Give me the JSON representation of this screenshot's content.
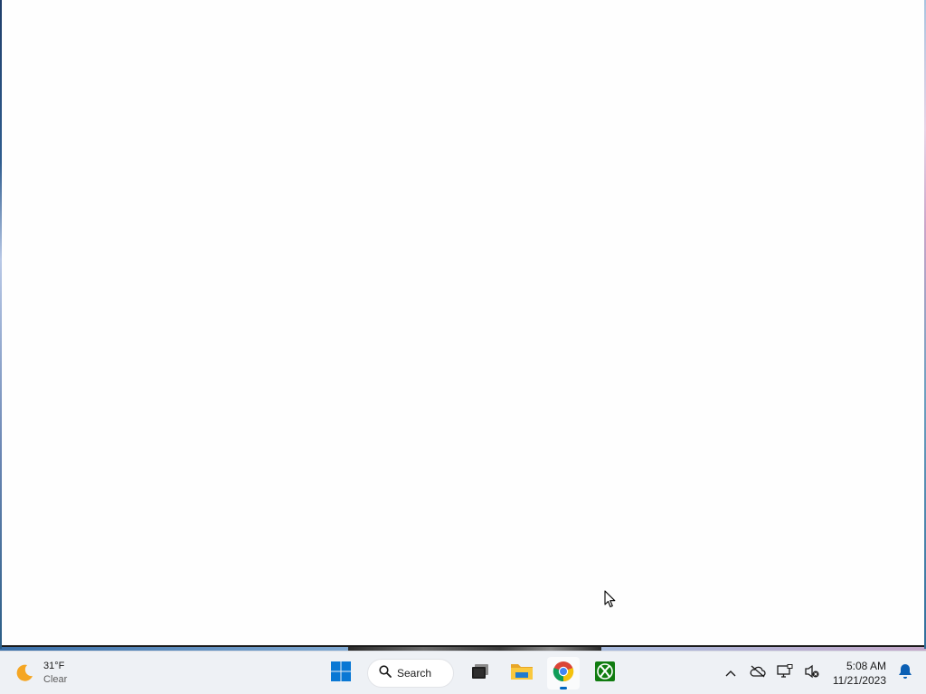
{
  "weather": {
    "temperature": "31°F",
    "condition": "Clear",
    "icon": "moon-icon"
  },
  "taskbar": {
    "search_label": "Search",
    "apps": [
      {
        "name": "start",
        "icon": "windows-logo-icon"
      },
      {
        "name": "task-view",
        "icon": "task-view-icon"
      },
      {
        "name": "file-explorer",
        "icon": "folder-icon"
      },
      {
        "name": "chrome",
        "icon": "chrome-icon",
        "active": true
      },
      {
        "name": "xbox",
        "icon": "xbox-icon"
      }
    ]
  },
  "tray": {
    "icons": [
      "chevron-up-icon",
      "cloud-offline-icon",
      "network-icon",
      "volume-muted-icon"
    ],
    "time": "5:08 AM",
    "date": "11/21/2023",
    "notification_icon": "bell-icon"
  },
  "colors": {
    "taskbar_bg": "#eef1f5",
    "accent": "#0067c0",
    "window_bg": "#fefefe"
  }
}
